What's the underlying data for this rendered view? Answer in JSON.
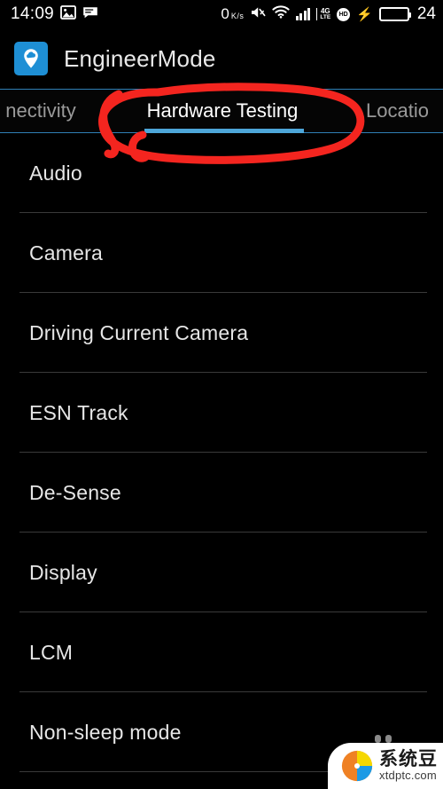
{
  "status_bar": {
    "time": "14:09",
    "icons_left": [
      "image-icon",
      "chat-icon"
    ],
    "network_speed": "0",
    "network_speed_unit_top": "K",
    "network_speed_unit_slash": "/",
    "network_speed_unit_bottom": "s",
    "mute_icon": "mute-icon",
    "wifi_icon": "wifi-icon",
    "signal_icon": "signal-bars-icon",
    "network_type_top": "4G",
    "network_type_bottom": "LTE",
    "hd_badge": "HD",
    "charging_icon": "charging-bolt-icon",
    "battery_level": "24",
    "battery_color": "#1fd21f"
  },
  "app_bar": {
    "icon_name": "engineermode-app-icon",
    "icon_bg": "#1e8fd5",
    "title": "EngineerMode"
  },
  "tabs": {
    "accent_color": "#4da6d9",
    "items": [
      {
        "label": "nectivity",
        "active": false
      },
      {
        "label": "Hardware Testing",
        "active": true
      },
      {
        "label": "Locatio",
        "active": false
      }
    ]
  },
  "list": {
    "items": [
      {
        "label": "Audio"
      },
      {
        "label": "Camera"
      },
      {
        "label": "Driving Current Camera"
      },
      {
        "label": "ESN Track"
      },
      {
        "label": "De-Sense"
      },
      {
        "label": "Display"
      },
      {
        "label": "LCM"
      },
      {
        "label": "Non-sleep mode"
      }
    ]
  },
  "annotation": {
    "shape": "hand-drawn-red-ellipse",
    "color": "#f4251f",
    "target": "Hardware Testing"
  },
  "watermark": {
    "name_cn": "系统豆",
    "url": "xtdptc.com",
    "logo_colors": {
      "orange": "#ef8124",
      "yellow": "#f5d800",
      "blue": "#1c9ae5"
    }
  }
}
